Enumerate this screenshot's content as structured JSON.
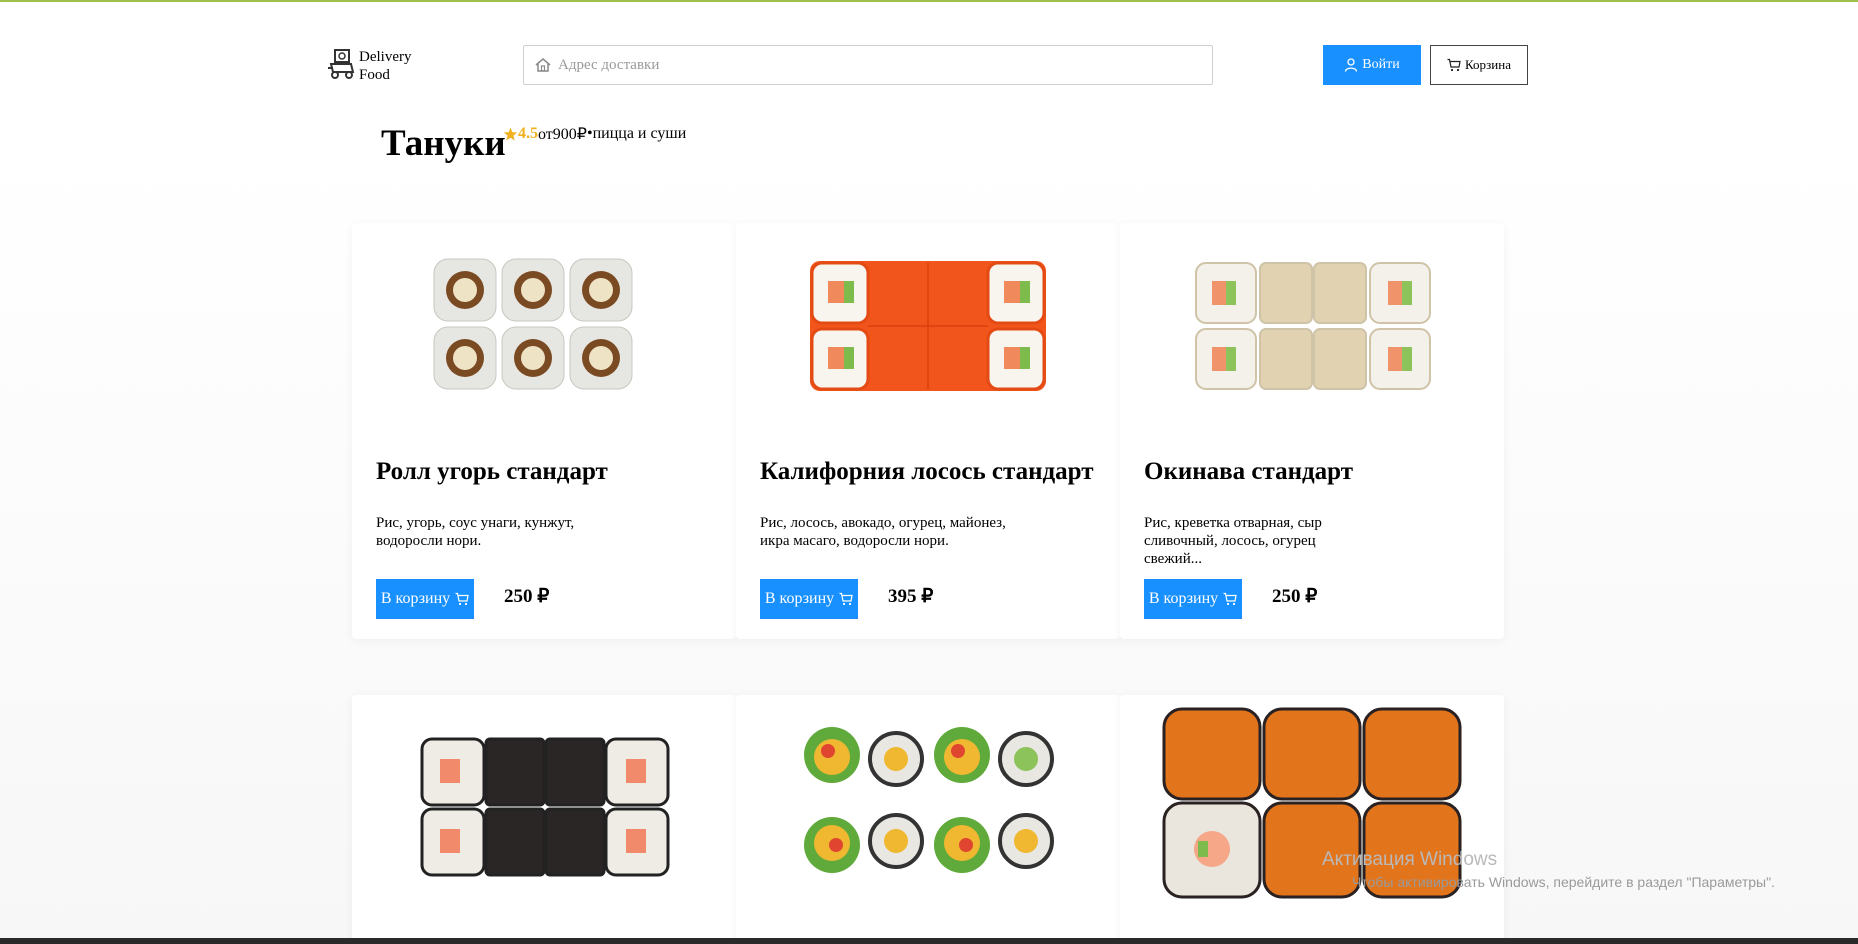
{
  "header": {
    "logo_line1": "Delivery",
    "logo_line2": "Food",
    "address_placeholder": "Адрес доставки",
    "login_label": "Войти",
    "cart_label": "Корзина"
  },
  "restaurant": {
    "name": "Тануки",
    "rating": "4.5",
    "price_from": "от900₽",
    "separator": "•",
    "category": "пицца и суши"
  },
  "cards": [
    {
      "title": "Ролл угорь стандарт",
      "description": "Рис, угорь, соус унаги, кунжут, водоросли нори.",
      "button": "В корзину",
      "price": "250 ₽"
    },
    {
      "title": "Калифорния лосось стандарт",
      "description": "Рис, лосось, авокадо, огурец, майонез, икра масаго, водоросли нори.",
      "button": "В корзину",
      "price": "395 ₽"
    },
    {
      "title": "Окинава стандарт",
      "description": "Рис, креветка отварная, сыр сливочный, лосось, огурец свежий...",
      "button": "В корзину",
      "price": "250 ₽"
    }
  ],
  "bottom_cards": [
    {
      "icon": "black-rice-roll-image"
    },
    {
      "icon": "lettuce-roll-image"
    },
    {
      "icon": "baked-roll-image"
    }
  ],
  "watermark": {
    "line1": "Активация Windows",
    "line2": "Чтобы активировать Windows, перейдите в раздел \"Параметры\"."
  },
  "colors": {
    "accent": "#1890ff",
    "rating": "#f2b01e",
    "topline": "#9cc04a"
  }
}
